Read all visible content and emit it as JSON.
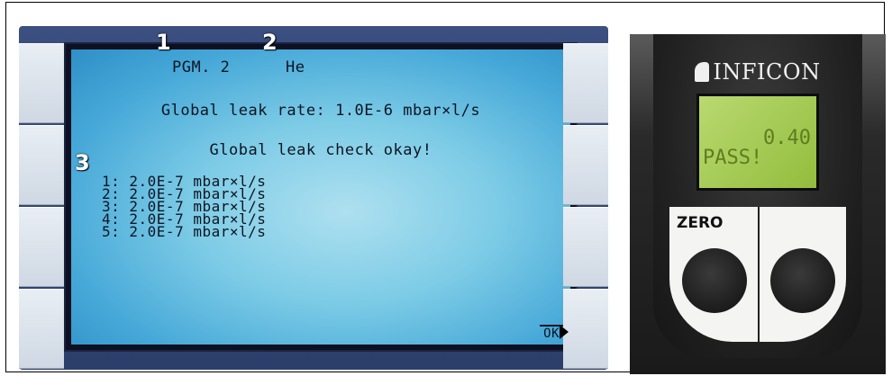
{
  "control_unit": {
    "header": {
      "program": "PGM. 2",
      "gas": "He"
    },
    "global_leak_rate": "Global leak rate: 1.0E-6 mbar×l/s",
    "status_message": "Global leak check okay!",
    "leak_points": [
      "1: 2.0E-7 mbar×l/s",
      "2: 2.0E-7 mbar×l/s",
      "3: 2.0E-7 mbar×l/s",
      "4: 2.0E-7 mbar×l/s",
      "5: 2.0E-7 mbar×l/s"
    ],
    "ok_softkey": "OK",
    "callouts": [
      "1",
      "2",
      "3"
    ]
  },
  "handheld": {
    "brand": "INFICON",
    "lcd_value": "0.40",
    "lcd_status": "PASS!",
    "zero_label": "ZERO",
    "colors": {
      "lcd_background": "#a8cc55",
      "lcd_text": "#5f7c20"
    }
  },
  "colors": {
    "screen_background": "#7ccbe6",
    "device_frame": "#34477a"
  }
}
